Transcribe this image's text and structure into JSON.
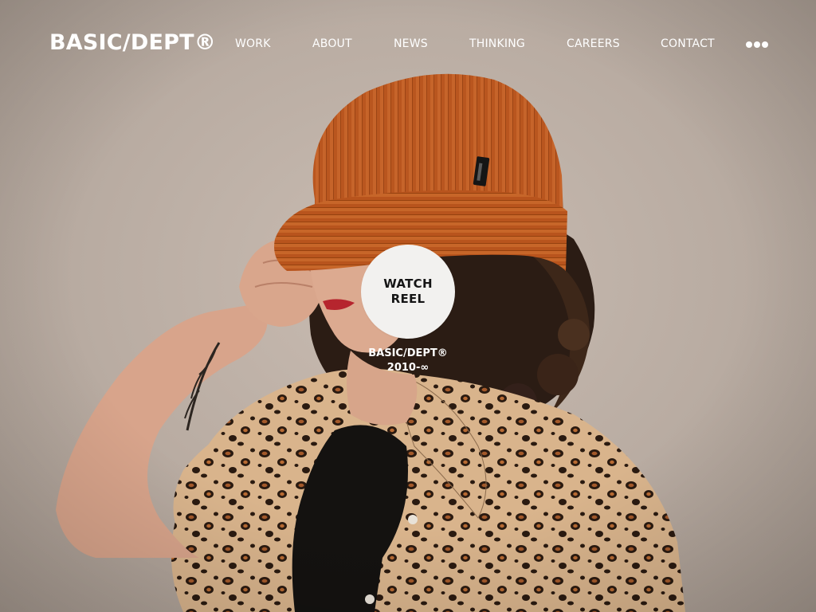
{
  "header": {
    "logo": "BASIC/DEPT®",
    "nav": [
      {
        "label": "WORK"
      },
      {
        "label": "ABOUT"
      },
      {
        "label": "NEWS"
      },
      {
        "label": "THINKING"
      },
      {
        "label": "CAREERS"
      },
      {
        "label": "CONTACT"
      }
    ],
    "menu_icon": "more-dots-icon"
  },
  "hero": {
    "image": "portrait-woman-orange-beanie-leopard-shirt",
    "reel_button": {
      "line1": "WATCH",
      "line2": "REEL"
    },
    "caption": {
      "line1": "BASIC/DEPT®",
      "line2": "2010-∞"
    }
  },
  "colors": {
    "background": "#c0b3a9",
    "beanie": "#b7541e",
    "text": "#ffffff",
    "button_bg": "#f2f1ef",
    "button_text": "#151515"
  }
}
